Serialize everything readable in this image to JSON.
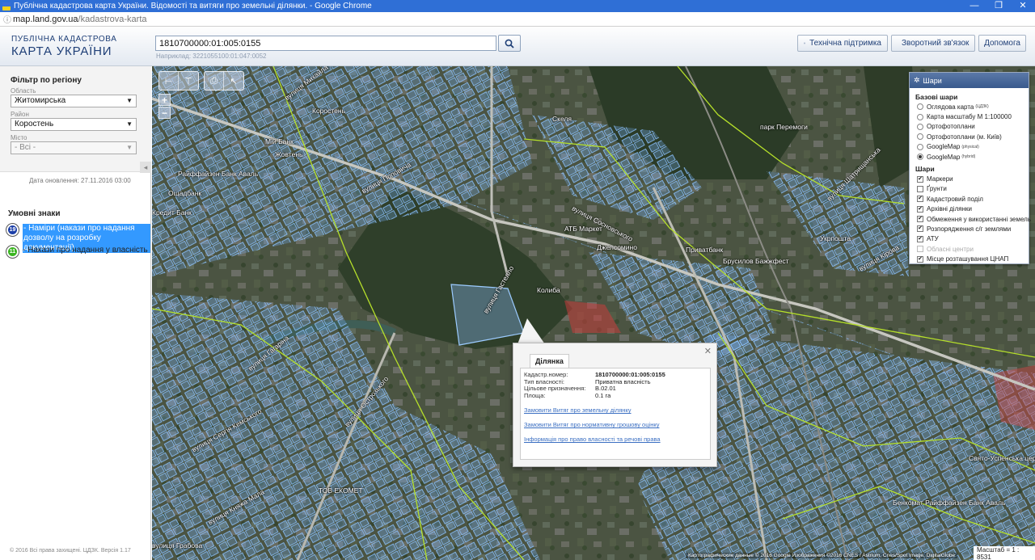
{
  "browser": {
    "window_title": "Публічна кадастрова карта України. Відомості та витяги про земельні ділянки. - Google Chrome",
    "url_domain": "map.land.gov.ua",
    "url_path": "/kadastrova-karta",
    "controls": {
      "minimize": "—",
      "restore": "❐",
      "close": "✕"
    }
  },
  "header": {
    "logo_line1": "ПУБЛІЧНА КАДАСТРОВА",
    "logo_line2": "КАРТА УКРАЇНИ",
    "search_value": "1810700000:01:005:0155",
    "search_hint": "Наприклад: 3221055100:01:047:0052",
    "buttons": {
      "support": "Технічна підтримка",
      "feedback": "Зворотний зв'язок",
      "help": "Допомога"
    }
  },
  "sidebar": {
    "filter_title": "Фільтр по регіону",
    "oblast_label": "Область",
    "oblast_value": "Житомирська",
    "raion_label": "Район",
    "raion_value": "Коростень",
    "misto_label": "Місто",
    "misto_value": "- Всі -",
    "update_date": "Дата оновлення: 27.11.2016 03:00",
    "legend_title": "Умовні знаки",
    "legend_items": [
      {
        "count": "19",
        "label": "- Наміри (накази про надання дозволу на розробку документації)",
        "color": "#1c3fa8"
      },
      {
        "count": "11",
        "label": "- Накази про надання у власність",
        "color": "#3ab520"
      }
    ],
    "copyright": "© 2016 Всі права захищені. ЦДЗК. Версія 1.17"
  },
  "layers": {
    "title": "Шари",
    "base_title": "Базові шари",
    "base": [
      {
        "label": "Оглядова карта",
        "sup": "(ЦДЗК)",
        "selected": false
      },
      {
        "label": "Карта масштабу М 1:100000",
        "sup": "",
        "selected": false
      },
      {
        "label": "Ортофотоплани",
        "sup": "",
        "selected": false
      },
      {
        "label": "Ортофотоплани (м. Київ)",
        "sup": "",
        "selected": false
      },
      {
        "label": "GoogleMap",
        "sup": "(physical)",
        "selected": false
      },
      {
        "label": "GoogleMap",
        "sup": "(hybrid)",
        "selected": true
      }
    ],
    "overlay_title": "Шари",
    "overlays": [
      {
        "label": "Маркери",
        "checked": true,
        "enabled": true
      },
      {
        "label": "Ґрунти",
        "checked": false,
        "enabled": true
      },
      {
        "label": "Кадастровий поділ",
        "checked": true,
        "enabled": true
      },
      {
        "label": "Архівні ділянки",
        "checked": true,
        "enabled": true
      },
      {
        "label": "Обмеження у використанні земель",
        "checked": true,
        "enabled": true
      },
      {
        "label": "Розпорядження с/г землями",
        "checked": true,
        "enabled": true
      },
      {
        "label": "АТУ",
        "checked": true,
        "enabled": true
      },
      {
        "label": "Обласні центри",
        "checked": false,
        "enabled": false
      },
      {
        "label": "Місце розташування ЦНАП",
        "checked": true,
        "enabled": true
      }
    ]
  },
  "popup": {
    "tab": "Ділянка",
    "fields": [
      {
        "k": "Кадастр.номер:",
        "v": "1810700000:01:005:0155",
        "bold": true
      },
      {
        "k": "Тип власності:",
        "v": "Приватна власність",
        "bold": false
      },
      {
        "k": "Цільове призначення:",
        "v": "В.02.01",
        "bold": false
      },
      {
        "k": "Площа:",
        "v": "0.1 га",
        "bold": false
      }
    ],
    "links": [
      "Замовити Витяг про земельну ділянку",
      "Замовити Витяг про нормативну грошову оцінку",
      "Інформація про право власності та речові права"
    ]
  },
  "map": {
    "scale": "Масштаб = 1 : 8531",
    "attribution": "Картографические данные © 2016 Google Изображения ©2016 CNES / Astrium, Cnes/Spot Image, DigitalGlobe",
    "labels": [
      {
        "t": "вулиця Михайла Грушевського"
      },
      {
        "t": "Коростень"
      },
      {
        "t": "Мій Банк"
      },
      {
        "t": "Жовтень"
      },
      {
        "t": "Райффайзен Банк Аваль"
      },
      {
        "t": "Ощадбанк"
      },
      {
        "t": "Кредит Банк"
      },
      {
        "t": "вулиця Сосновського"
      },
      {
        "t": "Скеля"
      },
      {
        "t": "парк Перемоги"
      },
      {
        "t": "АТБ Маркет"
      },
      {
        "t": "Джелсомино"
      },
      {
        "t": "Приватбанк"
      },
      {
        "t": "Брусилов Бажжфест"
      },
      {
        "t": "Укрпошта"
      },
      {
        "t": "Колиба"
      },
      {
        "t": "вулиця Гастелло"
      },
      {
        "t": "вулиця Шатрищанська"
      },
      {
        "t": "вулиця Кірова"
      },
      {
        "t": "вулиця Поповича"
      },
      {
        "t": "вулиця Гагаріна"
      },
      {
        "t": "вулиця Сергія Кемського"
      },
      {
        "t": "вулиця Острозького"
      },
      {
        "t": "вулиця Княжа Мала"
      },
      {
        "t": "вулиця Грабова"
      },
      {
        "t": "ТОВ ЕКОМЕТ"
      },
      {
        "t": "Бенкомат Райффайзен Банк Аваль"
      },
      {
        "t": "Свято-Успенська церква"
      }
    ]
  },
  "colors": {
    "accent": "#1f3f77",
    "legend_highlight": "#3399ff",
    "parcel_border": "#7ab8ff",
    "boundary": "#b6e02a"
  }
}
